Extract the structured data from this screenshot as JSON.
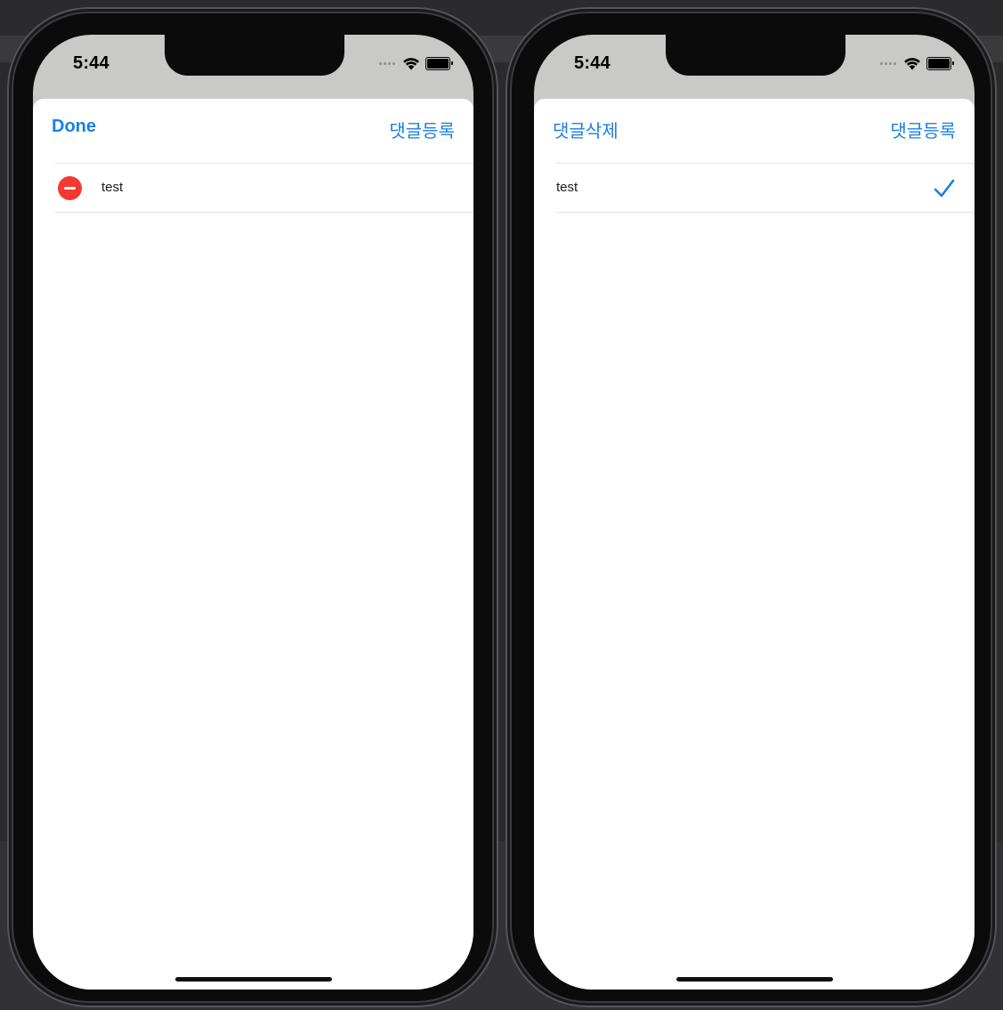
{
  "phones": [
    {
      "status": {
        "time": "5:44"
      },
      "nav": {
        "left_label": "Done",
        "right_label": "댓글등록"
      },
      "rows": [
        {
          "label": "test"
        }
      ]
    },
    {
      "status": {
        "time": "5:44"
      },
      "nav": {
        "left_label": "댓글삭제",
        "right_label": "댓글등록"
      },
      "rows": [
        {
          "label": "test"
        }
      ]
    }
  ],
  "colors": {
    "accent": "#1a7fe3",
    "delete": "#f23a33",
    "sheet": "#ffffff",
    "backdrop": "#c9cac8"
  },
  "icons": {
    "wifi": "wifi-icon",
    "battery": "battery-icon",
    "delete": "delete-minus-icon",
    "checkmark": "checkmark-icon"
  }
}
